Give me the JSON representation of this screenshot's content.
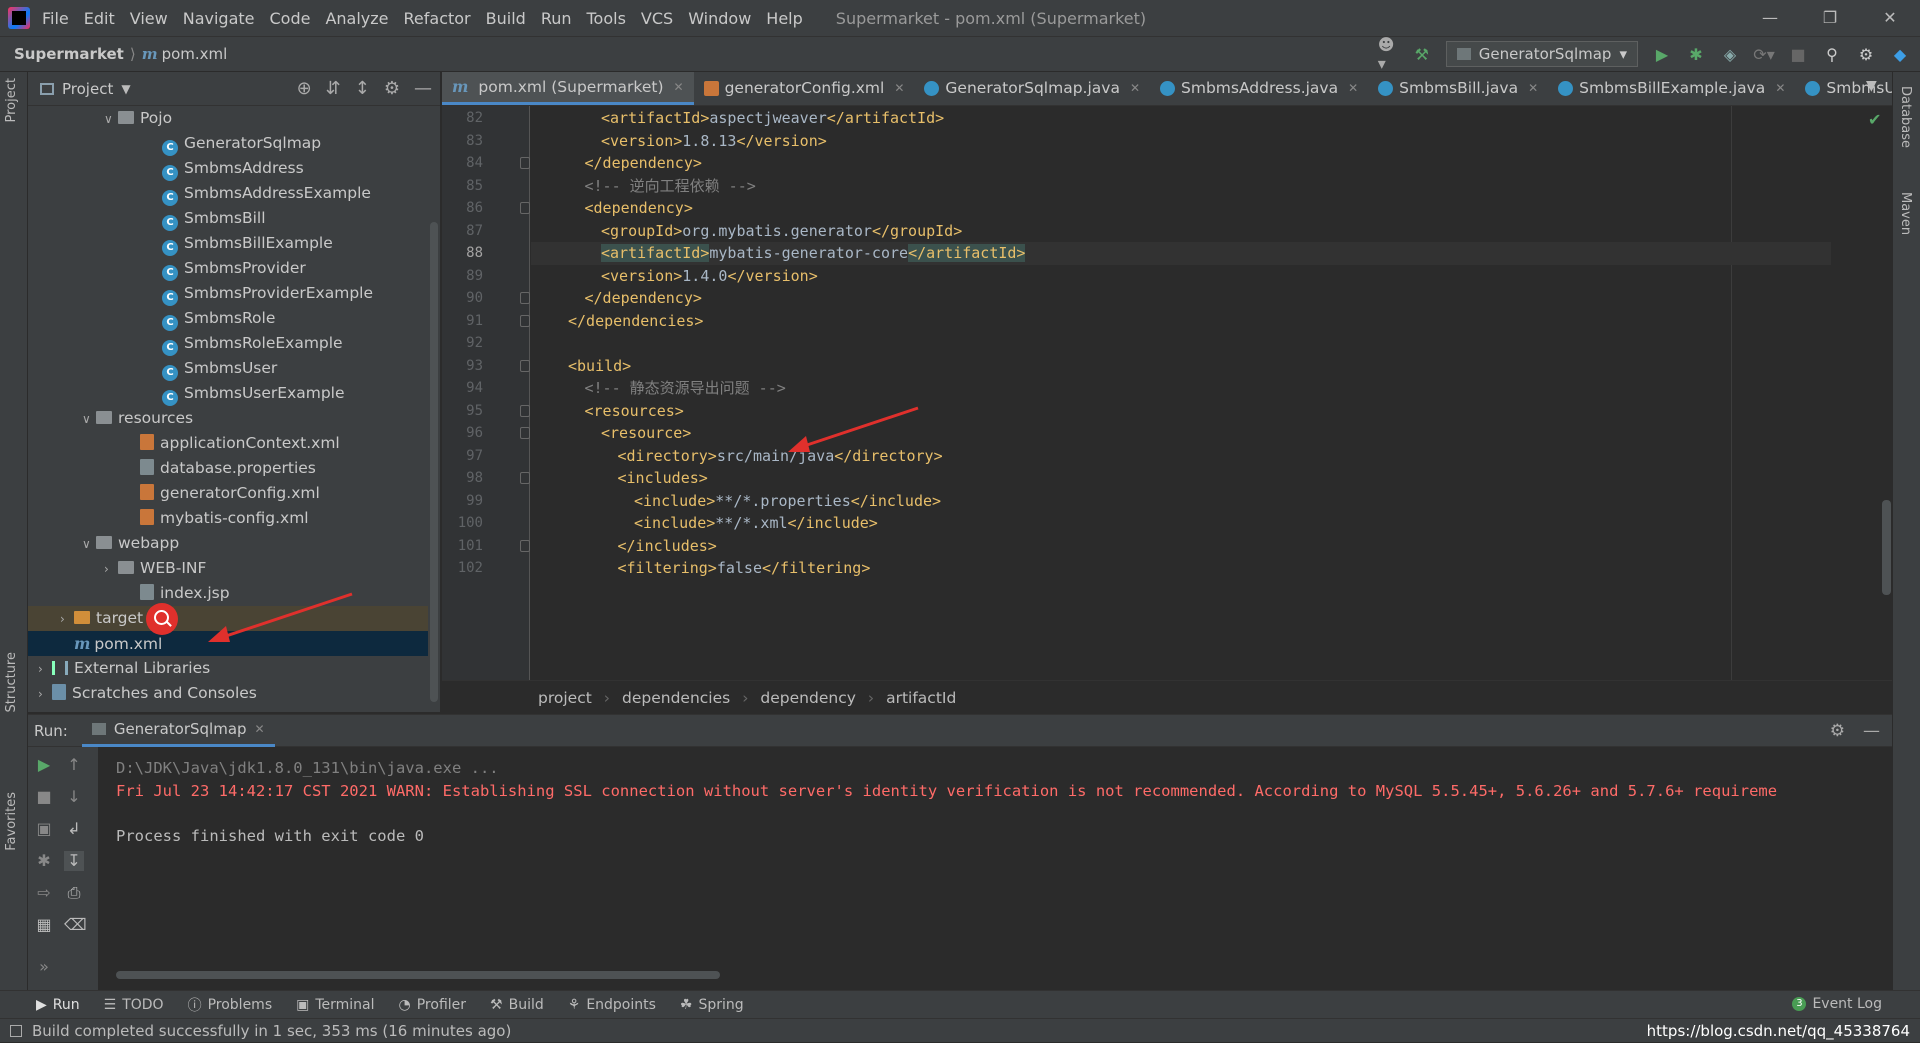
{
  "menubar": {
    "items": [
      "File",
      "Edit",
      "View",
      "Navigate",
      "Code",
      "Analyze",
      "Refactor",
      "Build",
      "Run",
      "Tools",
      "VCS",
      "Window",
      "Help"
    ],
    "title": "Supermarket - pom.xml (Supermarket)"
  },
  "navbar": {
    "project": "Supermarket",
    "file": "pom.xml",
    "run_config": "GeneratorSqlmap"
  },
  "left_stripe": {
    "project": "Project",
    "structure": "Structure",
    "favorites": "Favorites"
  },
  "right_stripe": {
    "database": "Database",
    "maven": "Maven"
  },
  "project_panel": {
    "title": "Project",
    "tree": [
      {
        "label": "Pojo",
        "kind": "folder",
        "indent": 3,
        "expanded": true
      },
      {
        "label": "GeneratorSqlmap",
        "kind": "class",
        "indent": 5
      },
      {
        "label": "SmbmsAddress",
        "kind": "class",
        "indent": 5
      },
      {
        "label": "SmbmsAddressExample",
        "kind": "class",
        "indent": 5
      },
      {
        "label": "SmbmsBill",
        "kind": "class",
        "indent": 5
      },
      {
        "label": "SmbmsBillExample",
        "kind": "class",
        "indent": 5
      },
      {
        "label": "SmbmsProvider",
        "kind": "class",
        "indent": 5
      },
      {
        "label": "SmbmsProviderExample",
        "kind": "class",
        "indent": 5
      },
      {
        "label": "SmbmsRole",
        "kind": "class",
        "indent": 5
      },
      {
        "label": "SmbmsRoleExample",
        "kind": "class",
        "indent": 5
      },
      {
        "label": "SmbmsUser",
        "kind": "class",
        "indent": 5
      },
      {
        "label": "SmbmsUserExample",
        "kind": "class",
        "indent": 5
      },
      {
        "label": "resources",
        "kind": "folder",
        "indent": 2,
        "expanded": true
      },
      {
        "label": "applicationContext.xml",
        "kind": "xml",
        "indent": 4
      },
      {
        "label": "database.properties",
        "kind": "props",
        "indent": 4
      },
      {
        "label": "generatorConfig.xml",
        "kind": "xml",
        "indent": 4
      },
      {
        "label": "mybatis-config.xml",
        "kind": "xml",
        "indent": 4
      },
      {
        "label": "webapp",
        "kind": "folder",
        "indent": 2,
        "expanded": true
      },
      {
        "label": "WEB-INF",
        "kind": "folder",
        "indent": 3,
        "expanded": false
      },
      {
        "label": "index.jsp",
        "kind": "props",
        "indent": 4
      },
      {
        "label": "target",
        "kind": "folder-orange",
        "indent": 1,
        "expanded": false,
        "highlight": true
      },
      {
        "label": "pom.xml",
        "kind": "maven",
        "indent": 1,
        "selected": true
      },
      {
        "label": "External Libraries",
        "kind": "lib",
        "indent": 0,
        "expanded": false
      },
      {
        "label": "Scratches and Consoles",
        "kind": "scratch",
        "indent": 0,
        "expanded": false
      }
    ]
  },
  "tabs": [
    {
      "label": "pom.xml (Supermarket)",
      "kind": "maven",
      "active": true
    },
    {
      "label": "generatorConfig.xml",
      "kind": "xml"
    },
    {
      "label": "GeneratorSqlmap.java",
      "kind": "class"
    },
    {
      "label": "SmbmsAddress.java",
      "kind": "class"
    },
    {
      "label": "SmbmsBill.java",
      "kind": "class"
    },
    {
      "label": "SmbmsBillExample.java",
      "kind": "class"
    },
    {
      "label": "SmbmsUser.j",
      "kind": "class"
    }
  ],
  "editor": {
    "current_line": 88,
    "lines": [
      {
        "n": "82",
        "indent": 4,
        "code": [
          [
            "tag",
            "<artifactId>"
          ],
          [
            "txt",
            "aspectjweaver"
          ],
          [
            "tag",
            "</artifactId>"
          ]
        ]
      },
      {
        "n": "83",
        "indent": 4,
        "code": [
          [
            "tag",
            "<version>"
          ],
          [
            "txt",
            "1.8.13"
          ],
          [
            "tag",
            "</version>"
          ]
        ]
      },
      {
        "n": "84",
        "indent": 3,
        "code": [
          [
            "tag",
            "</dependency>"
          ]
        ]
      },
      {
        "n": "85",
        "indent": 3,
        "code": [
          [
            "cmt",
            "<!-- 逆向工程依赖 -->"
          ]
        ]
      },
      {
        "n": "86",
        "indent": 3,
        "code": [
          [
            "tag",
            "<dependency>"
          ]
        ]
      },
      {
        "n": "87",
        "indent": 4,
        "code": [
          [
            "tag",
            "<groupId>"
          ],
          [
            "txt",
            "org.mybatis.generator"
          ],
          [
            "tag",
            "</groupId>"
          ]
        ]
      },
      {
        "n": "88",
        "indent": 4,
        "code": [
          [
            "hltag",
            "<artifactId>"
          ],
          [
            "txt",
            "mybatis-generator-core"
          ],
          [
            "hltag",
            "</artifactId>"
          ]
        ]
      },
      {
        "n": "89",
        "indent": 4,
        "code": [
          [
            "tag",
            "<version>"
          ],
          [
            "txt",
            "1.4.0"
          ],
          [
            "tag",
            "</version>"
          ]
        ]
      },
      {
        "n": "90",
        "indent": 3,
        "code": [
          [
            "tag",
            "</dependency>"
          ]
        ]
      },
      {
        "n": "91",
        "indent": 2,
        "code": [
          [
            "tag",
            "</dependencies>"
          ]
        ]
      },
      {
        "n": "92",
        "indent": 0,
        "code": []
      },
      {
        "n": "93",
        "indent": 2,
        "code": [
          [
            "tag",
            "<build>"
          ]
        ]
      },
      {
        "n": "94",
        "indent": 3,
        "code": [
          [
            "cmt",
            "<!-- 静态资源导出问题 -->"
          ]
        ]
      },
      {
        "n": "95",
        "indent": 3,
        "code": [
          [
            "tag",
            "<resources>"
          ]
        ]
      },
      {
        "n": "96",
        "indent": 4,
        "code": [
          [
            "tag",
            "<resource>"
          ]
        ]
      },
      {
        "n": "97",
        "indent": 5,
        "code": [
          [
            "tag",
            "<directory>"
          ],
          [
            "txt",
            "src/main/java"
          ],
          [
            "tag",
            "</directory>"
          ]
        ]
      },
      {
        "n": "98",
        "indent": 5,
        "code": [
          [
            "tag",
            "<includes>"
          ]
        ]
      },
      {
        "n": "99",
        "indent": 6,
        "code": [
          [
            "tag",
            "<include>"
          ],
          [
            "txt",
            "**/*.properties"
          ],
          [
            "tag",
            "</include>"
          ]
        ]
      },
      {
        "n": "100",
        "indent": 6,
        "code": [
          [
            "tag",
            "<include>"
          ],
          [
            "txt",
            "**/*.xml"
          ],
          [
            "tag",
            "</include>"
          ]
        ]
      },
      {
        "n": "101",
        "indent": 5,
        "code": [
          [
            "tag",
            "</includes>"
          ]
        ]
      },
      {
        "n": "102",
        "indent": 5,
        "code": [
          [
            "tag",
            "<filtering>"
          ],
          [
            "txt",
            "false"
          ],
          [
            "tag",
            "</filtering>"
          ]
        ]
      }
    ]
  },
  "breadcrumb": [
    "project",
    "dependencies",
    "dependency",
    "artifactId"
  ],
  "run_panel": {
    "label": "Run:",
    "tab": "GeneratorSqlmap",
    "console": [
      {
        "text": "D:\\JDK\\Java\\jdk1.8.0_131\\bin\\java.exe ...",
        "color": "#808080"
      },
      {
        "text": "Fri Jul 23 14:42:17 CST 2021 WARN: Establishing SSL connection without server's identity verification is not recommended. According to MySQL 5.5.45+, 5.6.26+ and 5.7.6+ requireme",
        "color": "#ff6b68"
      },
      {
        "text": "",
        "color": "#bbbbbb"
      },
      {
        "text": "Process finished with exit code 0",
        "color": "#bbbbbb"
      }
    ]
  },
  "tool_tabs": [
    "Run",
    "TODO",
    "Problems",
    "Terminal",
    "Profiler",
    "Build",
    "Endpoints",
    "Spring"
  ],
  "event_log": {
    "label": "Event Log",
    "count": "3"
  },
  "status": {
    "message": "Build completed successfully in 1 sec, 353 ms (16 minutes ago)",
    "watermark": "https://blog.csdn.net/qq_45338764"
  },
  "colors": {
    "tag": "#e8bf6a",
    "text": "#a9b7c6",
    "comment": "#808080",
    "error": "#ff6b68",
    "accent": "#4a88c7",
    "annotation": "#e0302c"
  }
}
